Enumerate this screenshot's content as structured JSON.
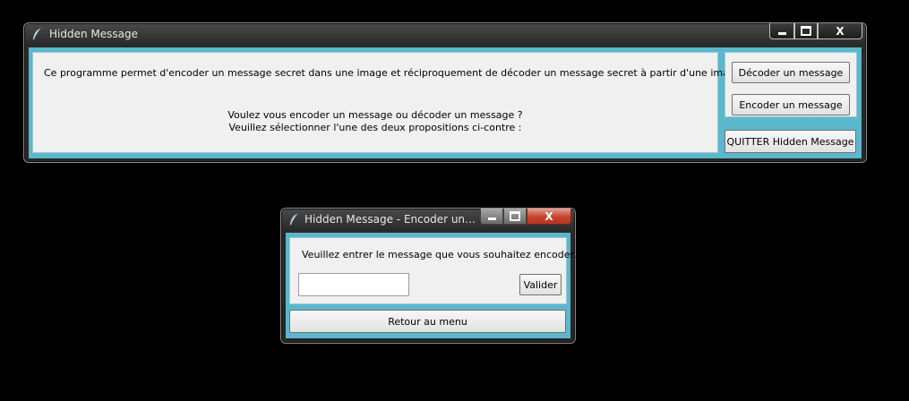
{
  "main_window": {
    "title": "Hidden Message",
    "intro_text": "Ce programme permet d'encoder un message secret dans une image et réciproquement de décoder un message secret à partir d'une image.",
    "question_line1": "Voulez vous encoder un message ou décoder un message ?",
    "question_line2": "Veuillez sélectionner l'une des deux propositions ci-contre  :",
    "decode_button": "Décoder un message",
    "encode_button": "Encoder un message",
    "quit_button": "QUITTER Hidden Message"
  },
  "encode_window": {
    "title": "Hidden Message - Encoder un me...",
    "prompt": "Veuillez entrer le message que vous souhaitez encoder.",
    "message_input_value": "",
    "validate_button": "Valider",
    "back_button": "Retour au menu"
  },
  "window_controls": {
    "close_glyph": "X"
  },
  "colors": {
    "client_bg": "#5ab7cc",
    "panel_bg": "#f0f0f0",
    "desktop": "#000000"
  }
}
